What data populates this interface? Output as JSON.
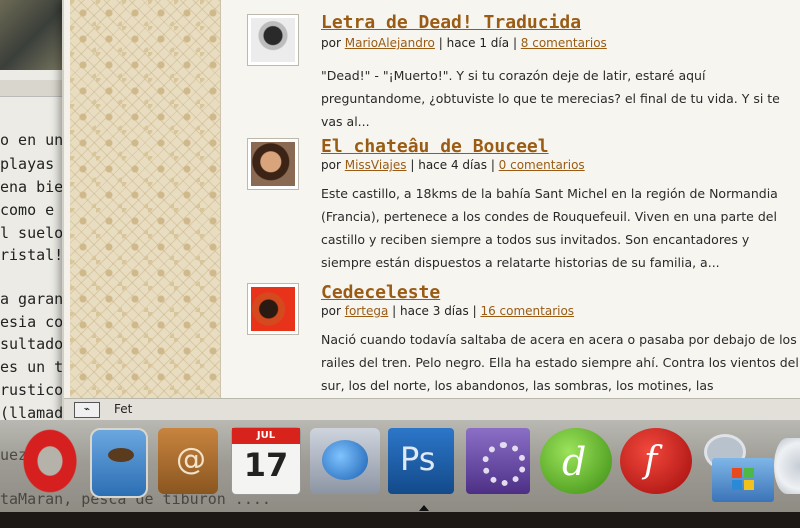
{
  "background_window": {
    "text_lines": [
      "o en un",
      "playas c",
      "ena bien",
      "como e",
      "l suelo",
      "ristal! E",
      "a garant",
      "esia cor",
      "sultado",
      "es un ti",
      "rustico",
      "(llamad"
    ]
  },
  "posts": [
    {
      "title": "Letra de Dead! Traducida",
      "author_prefix": "por",
      "author": "MarioAlejandro",
      "time": "hace 1 día",
      "comments": "8 comentarios",
      "excerpt": "\"Dead!\" - \"¡Muerto!\".   Y si tu corazón deje de latir, estaré aquí preguntandome, ¿obtuviste lo que te merecias? el final de tu vida.   Y si te vas al..."
    },
    {
      "title": "El chateâu de Bouceel",
      "author_prefix": "por",
      "author": "MissViajes",
      "time": "hace 4 días",
      "comments": "0 comentarios",
      "excerpt": "Este castillo, a 18kms de la bahía Sant Michel en la región de Normandia (Francia), pertenece a los condes de Rouquefeuil. Viven en una parte del castillo y reciben siempre a todos sus invitados. Son encantadores y siempre están dispuestos a relatarte historias de su familia, a..."
    },
    {
      "title": "Cedeceleste",
      "author_prefix": "por",
      "author": "fortega",
      "time": "hace 3 días",
      "comments": "16 comentarios",
      "excerpt": "Nació cuando todavía saltaba de acera en acera o pasaba por debajo de los railes del tren. Pelo negro. Ella ha estado siempre ahí. Contra los vientos del sur, los del norte, los abandonos, las sombras, los motines, las"
    }
  ],
  "statusbar": {
    "text": "Fet"
  },
  "dock": {
    "calendar": {
      "month": "JUL",
      "day": "17"
    },
    "photoshop_label": "Ps",
    "address_book_label": "@",
    "under_text": [
      "uez       a",
      "taMaran, pesca de tiburon ...."
    ],
    "icons": [
      "opera-icon",
      "preview-eagle-icon",
      "address-book-icon",
      "ical-icon",
      "network-utility-icon",
      "photoshop-icon",
      "system-preferences-icon",
      "dreamweaver-icon",
      "flash-icon",
      "satellite-dish-icon",
      "windows-icon",
      "dvd-icon"
    ]
  },
  "colors": {
    "link": "#9a5c14",
    "accent_flash": "#d11818",
    "accent_dreamweaver": "#5cad1e",
    "accent_photoshop": "#1e5fa8"
  }
}
